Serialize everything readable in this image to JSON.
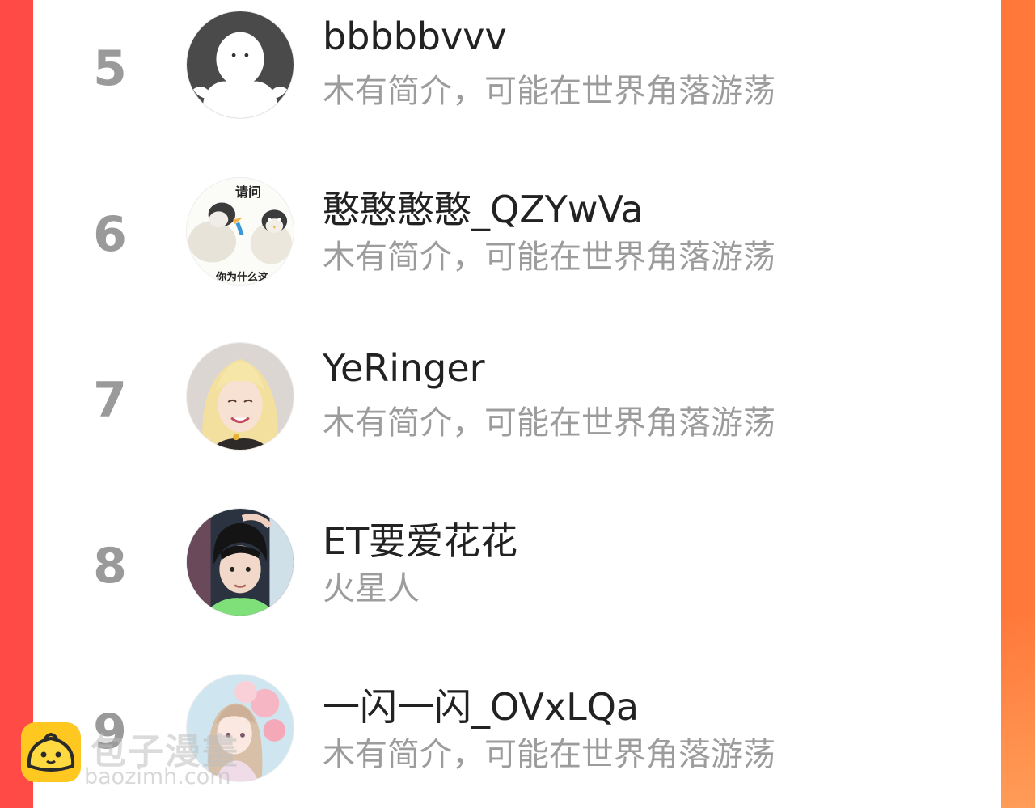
{
  "ranking": {
    "items": [
      {
        "rank": "5",
        "name": "bbbbbvvv",
        "bio": "木有简介，可能在世界角落游荡",
        "avatar_icon": "default-user-silhouette-icon"
      },
      {
        "rank": "6",
        "name": "憨憨憨憨_QZYwVa",
        "bio": "木有简介，可能在世界角落游荡",
        "avatar_icon": "penguin-meme-avatar",
        "avatar_text_top": "请问",
        "avatar_text_bottom": "你为什么这"
      },
      {
        "rank": "7",
        "name": "YeRinger",
        "bio": "木有简介，可能在世界角落游荡",
        "avatar_icon": "blonde-girl-photo-avatar"
      },
      {
        "rank": "8",
        "name": "ET要爱花花",
        "bio": "火星人",
        "avatar_icon": "boy-photo-avatar"
      },
      {
        "rank": "9",
        "name": "一闪一闪_OVxLQa",
        "bio": "木有简介，可能在世界角落游荡",
        "avatar_icon": "anime-girl-balloons-avatar"
      }
    ]
  },
  "watermark": {
    "title": "包子漫畫",
    "url": "baozimh.com",
    "logo_icon": "bun-mascot-icon"
  },
  "colors": {
    "frame_left": "#ff4a45",
    "frame_right": "#ff7a3a",
    "rank_gray": "#9a9a9a",
    "bio_gray": "#9c9c9c",
    "logo_yellow": "#ffc820"
  }
}
